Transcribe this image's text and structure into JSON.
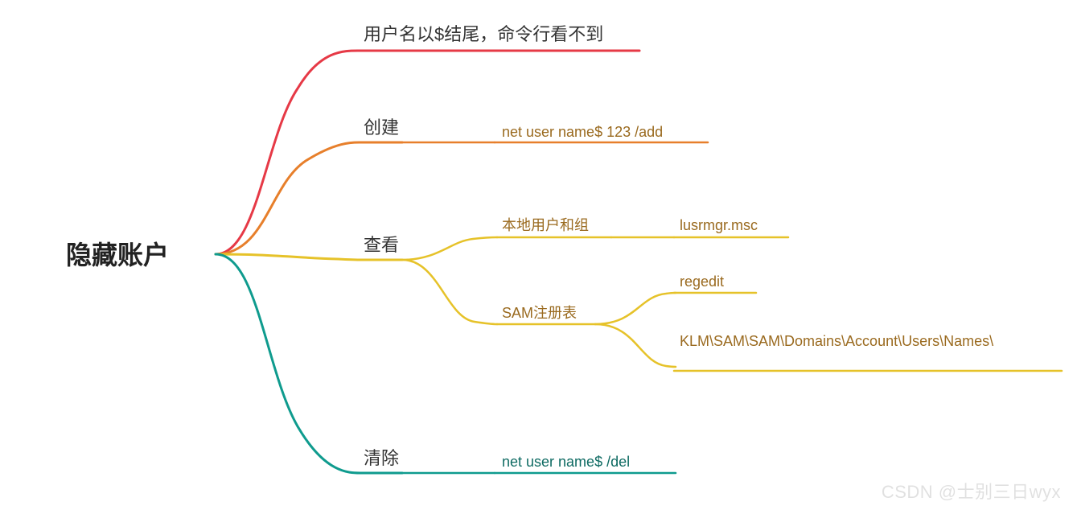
{
  "root": {
    "label": "隐藏账户"
  },
  "branches": {
    "b1": {
      "label": "用户名以$结尾，命令行看不到",
      "color": "#e63946"
    },
    "b2": {
      "label": "创建",
      "color": "#e77f2b",
      "leaf": {
        "text": "net user name$ 123 /add",
        "color": "#9a6a1f"
      }
    },
    "b3": {
      "label": "查看",
      "color": "#e6c229",
      "children": {
        "c1": {
          "label": "本地用户和组",
          "color": "#9a6a1f",
          "leaf": {
            "text": "lusrmgr.msc",
            "color": "#9a6a1f"
          }
        },
        "c2": {
          "label": "SAM注册表",
          "color": "#9a6a1f",
          "leaves": {
            "d1": {
              "text": "regedit",
              "color": "#9a6a1f"
            },
            "d2": {
              "text": "KLM\\SAM\\SAM\\Domains\\Account\\Users\\Names\\",
              "color": "#9a6a1f"
            }
          }
        }
      }
    },
    "b4": {
      "label": "清除",
      "color": "#0f9b8e",
      "leaf": {
        "text": "net user name$ /del",
        "color": "#0f6b63"
      }
    }
  },
  "watermark": "CSDN @士别三日wyx",
  "colors": {
    "red": "#e63946",
    "orange": "#e77f2b",
    "yellow": "#e6c229",
    "teal": "#0f9b8e",
    "olive": "#a88310"
  }
}
